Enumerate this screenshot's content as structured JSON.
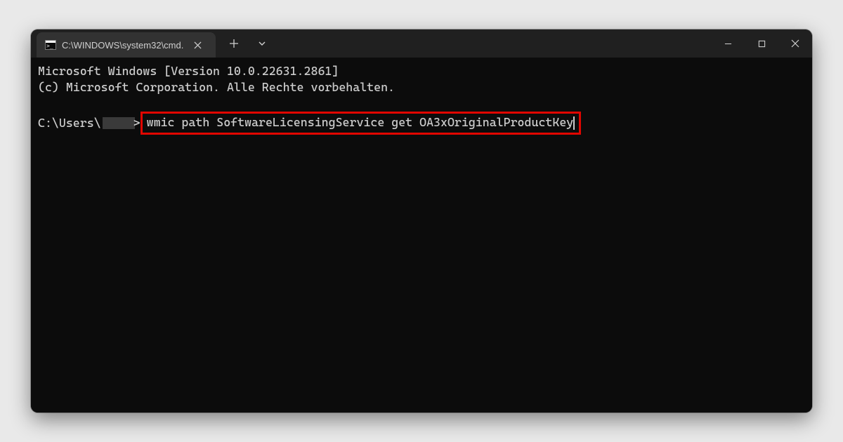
{
  "titlebar": {
    "tab_title": "C:\\WINDOWS\\system32\\cmd.",
    "term_icon_glyph": ">_"
  },
  "terminal": {
    "banner_line1": "Microsoft Windows [Version 10.0.22631.2861]",
    "banner_line2": "(c) Microsoft Corporation. Alle Rechte vorbehalten.",
    "prompt_prefix": "C:\\Users\\",
    "prompt_suffix": ">",
    "command": "wmic path SoftwareLicensingService get OA3xOriginalProductKey"
  },
  "colors": {
    "highlight": "#e10600"
  }
}
